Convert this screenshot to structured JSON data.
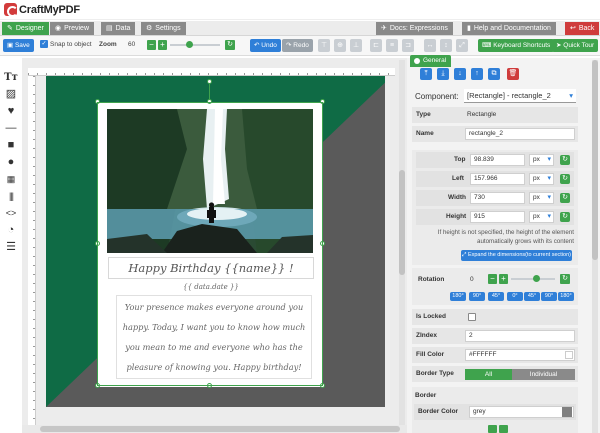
{
  "brand": {
    "name": "CraftMyPDF"
  },
  "tabs": [
    {
      "label": "Designer",
      "icon": "pencil-icon"
    },
    {
      "label": "Preview",
      "icon": "eye-icon"
    },
    {
      "label": "Data",
      "icon": "database-icon"
    },
    {
      "label": "Settings",
      "icon": "gears-icon"
    },
    {
      "label": "Docs: Expressions",
      "icon": "plane-icon"
    },
    {
      "label": "Help and Documentation",
      "icon": "book-icon"
    },
    {
      "label": "Back",
      "icon": "back-arrow-icon"
    }
  ],
  "toolbar": {
    "save_label": "Save",
    "snap_label": "Snap to object",
    "zoom_label": "Zoom",
    "zoom_value": "60",
    "undo_label": "Undo",
    "redo_label": "Redo",
    "shortcuts_label": "Keyboard Shortcuts",
    "tour_label": "Quick Tour"
  },
  "card": {
    "title": "Happy Birthday {{name}} !",
    "date": "{{ data.date }}",
    "message_lines": [
      "Your presence makes everyone around you",
      "happy. Today, I want you to know how much",
      "you mean to me and everyone who has the",
      "pleasure of knowing you. Happy birthday!"
    ]
  },
  "panel": {
    "tab_label": "General",
    "component_label": "Component:",
    "component_value": "[Rectangle] - rectangle_2",
    "type_label": "Type",
    "type_value": "Rectangle",
    "name_label": "Name",
    "name_value": "rectangle_2",
    "top_label": "Top",
    "top_value": "98.839",
    "left_label": "Left",
    "left_value": "157.966",
    "width_label": "Width",
    "width_value": "730",
    "height_label": "Height",
    "height_value": "915",
    "unit": "px",
    "height_note_1": "If height is not specified, the height of the element",
    "height_note_2": "automatically grows with its content",
    "expand_label": "Expand the dimensions(to current section)",
    "rotation_label": "Rotation",
    "rotation_value": "0",
    "rotation_presets": [
      "180°",
      "90°",
      "45°",
      "0°",
      "45°",
      "90°",
      "180°"
    ],
    "locked_label": "Is Locked",
    "zindex_label": "ZIndex",
    "zindex_value": "2",
    "fill_label": "Fill Color",
    "fill_value": "#FFFFFF",
    "border_type_label": "Border Type",
    "border_all": "All",
    "border_individual": "Individual",
    "border_section": "Border",
    "border_color_label": "Border Color",
    "border_color_value": "grey"
  },
  "colors": {
    "accent_green": "#3fa34d",
    "accent_blue": "#2f7fd8",
    "danger_red": "#cf3c3c",
    "page_green": "#0f6b45",
    "page_grey": "#5a5a5a"
  }
}
